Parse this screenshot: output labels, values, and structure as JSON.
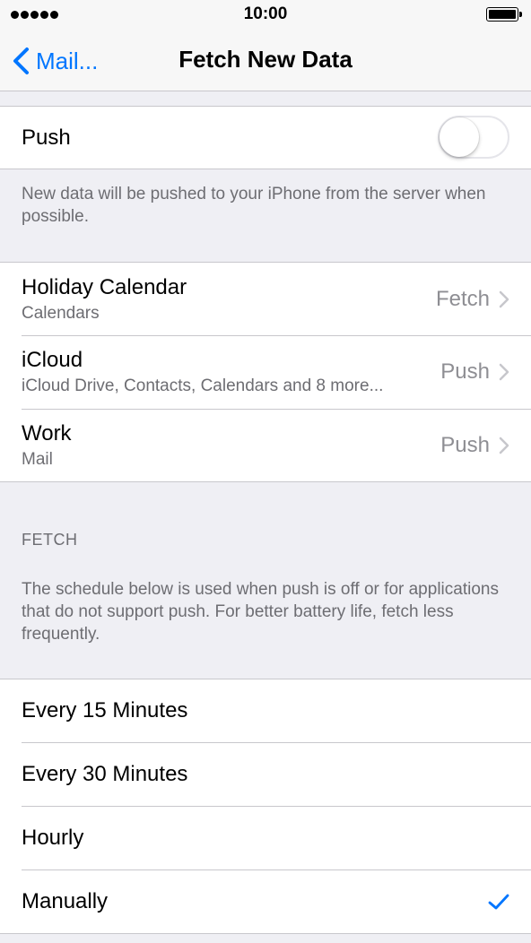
{
  "status_bar": {
    "time": "10:00"
  },
  "nav": {
    "back_label": "Mail...",
    "title": "Fetch New Data"
  },
  "push": {
    "label": "Push",
    "enabled": false,
    "footnote": "New data will be pushed to your iPhone from the server when possible."
  },
  "accounts": [
    {
      "name": "Holiday Calendar",
      "services": "Calendars",
      "mode": "Fetch"
    },
    {
      "name": "iCloud",
      "services": "iCloud Drive, Contacts, Calendars and 8 more...",
      "mode": "Push"
    },
    {
      "name": "Work",
      "services": "Mail",
      "mode": "Push"
    }
  ],
  "fetch": {
    "header": "FETCH",
    "description": "The schedule below is used when push is off or for applications that do not support push. For better battery life, fetch less frequently.",
    "options": [
      {
        "label": "Every 15 Minutes",
        "selected": false
      },
      {
        "label": "Every 30 Minutes",
        "selected": false
      },
      {
        "label": "Hourly",
        "selected": false
      },
      {
        "label": "Manually",
        "selected": true
      }
    ]
  },
  "colors": {
    "tint": "#0076ff",
    "background": "#efeff4",
    "separator": "#c8c7cc",
    "secondary_text": "#6d6d72"
  }
}
